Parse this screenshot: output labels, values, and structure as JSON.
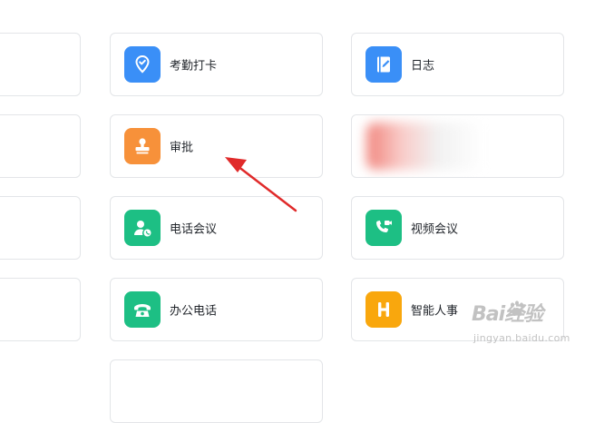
{
  "apps": [
    {
      "label": "考勤打卡",
      "icon": "location-check-icon",
      "color": "#3a8ff7"
    },
    {
      "label": "日志",
      "icon": "journal-edit-icon",
      "color": "#3a8ff7"
    },
    {
      "label": "审批",
      "icon": "stamp-icon",
      "color": "#f7913a"
    },
    {
      "label": "电话会议",
      "icon": "phone-conference-icon",
      "color": "#1dbf84"
    },
    {
      "label": "视频会议",
      "icon": "video-call-icon",
      "color": "#1dbf84"
    },
    {
      "label": "办公电话",
      "icon": "office-phone-icon",
      "color": "#1dbf84"
    },
    {
      "label": "智能人事",
      "icon": "hr-icon",
      "color": "#f9a70d"
    }
  ],
  "annotation_color": "#e02a2a",
  "watermark": {
    "main": "Bai经验",
    "sub": "jingyan.baidu.com"
  }
}
